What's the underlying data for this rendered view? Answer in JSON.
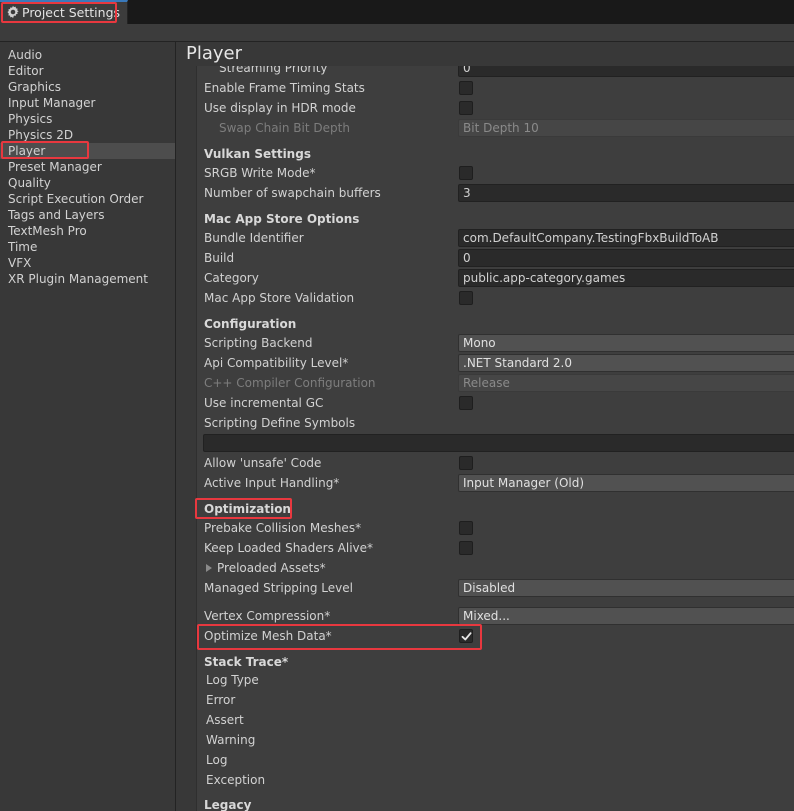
{
  "window": {
    "tab_title": "Project Settings",
    "tab_icon": "gear-icon"
  },
  "sidebar": {
    "items": [
      {
        "label": "Audio"
      },
      {
        "label": "Editor"
      },
      {
        "label": "Graphics"
      },
      {
        "label": "Input Manager"
      },
      {
        "label": "Physics"
      },
      {
        "label": "Physics 2D"
      },
      {
        "label": "Player",
        "selected": true
      },
      {
        "label": "Preset Manager"
      },
      {
        "label": "Quality"
      },
      {
        "label": "Script Execution Order"
      },
      {
        "label": "Tags and Layers"
      },
      {
        "label": "TextMesh Pro"
      },
      {
        "label": "Time"
      },
      {
        "label": "VFX"
      },
      {
        "label": "XR Plugin Management"
      }
    ]
  },
  "main": {
    "title": "Player",
    "rows": {
      "streaming_priority": {
        "label": "Streaming Priority",
        "value": "0"
      },
      "frame_timing": {
        "label": "Enable Frame Timing Stats",
        "checked": false
      },
      "hdr_display": {
        "label": "Use display in HDR mode",
        "checked": false
      },
      "swap_chain": {
        "label": "Swap Chain Bit Depth",
        "value": "Bit Depth 10"
      },
      "vulkan_title": "Vulkan Settings",
      "srgb_write": {
        "label": "SRGB Write Mode*",
        "checked": false
      },
      "swapchain_buffers": {
        "label": "Number of swapchain buffers",
        "value": "3"
      },
      "mac_title": "Mac App Store Options",
      "bundle_id": {
        "label": "Bundle Identifier",
        "value": "com.DefaultCompany.TestingFbxBuildToAB"
      },
      "build": {
        "label": "Build",
        "value": "0"
      },
      "category": {
        "label": "Category",
        "value": "public.app-category.games"
      },
      "mac_validation": {
        "label": "Mac App Store Validation",
        "checked": false
      },
      "config_title": "Configuration",
      "scripting_backend": {
        "label": "Scripting Backend",
        "value": "Mono"
      },
      "api_level": {
        "label": "Api Compatibility Level*",
        "value": ".NET Standard 2.0"
      },
      "cpp_config": {
        "label": "C++ Compiler Configuration",
        "value": "Release"
      },
      "incremental_gc": {
        "label": "Use incremental GC",
        "checked": false
      },
      "define_symbols": {
        "label": "Scripting Define Symbols",
        "value": ""
      },
      "unsafe_code": {
        "label": "Allow 'unsafe' Code",
        "checked": false
      },
      "input_handling": {
        "label": "Active Input Handling*",
        "value": "Input Manager (Old)"
      },
      "optimization_title": "Optimization",
      "prebake": {
        "label": "Prebake Collision Meshes*",
        "checked": false
      },
      "keep_shaders": {
        "label": "Keep Loaded Shaders Alive*",
        "checked": false
      },
      "preloaded_assets": {
        "label": "Preloaded Assets*"
      },
      "stripping": {
        "label": "Managed Stripping Level",
        "value": "Disabled"
      },
      "vertex_compression": {
        "label": "Vertex Compression*",
        "value": "Mixed..."
      },
      "optimize_mesh": {
        "label": "Optimize Mesh Data*",
        "checked": true
      },
      "stack_trace_title": "Stack Trace*",
      "stack_trace_items": [
        "Log Type",
        "Error",
        "Assert",
        "Warning",
        "Log",
        "Exception"
      ],
      "legacy_title": "Legacy"
    }
  },
  "colors": {
    "highlight": "#e8383f",
    "tab_accent": "#3a79bb"
  }
}
